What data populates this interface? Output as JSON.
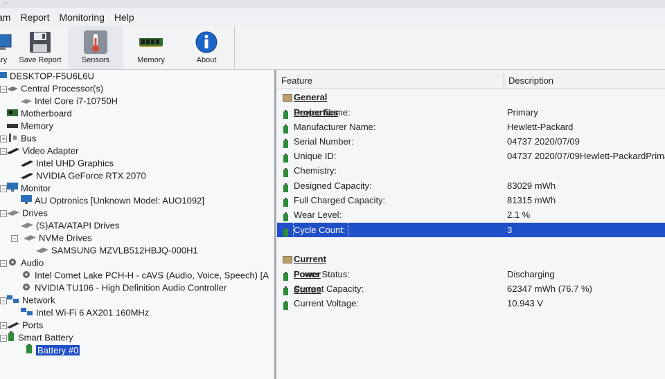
{
  "window": {
    "title_fragment": "..."
  },
  "menu": {
    "items": [
      "am",
      "Report",
      "Monitoring",
      "Help"
    ]
  },
  "toolbar": {
    "summary_label": "mary",
    "save_report_label": "Save Report",
    "sensors_label": "Sensors",
    "memory_label": "Memory",
    "about_label": "About"
  },
  "tree": {
    "root": "DESKTOP-F5U6L6U",
    "cpu": "Central Processor(s)",
    "cpu_item": "Intel Core i7-10750H",
    "motherboard": "Motherboard",
    "memory": "Memory",
    "bus": "Bus",
    "video": "Video Adapter",
    "video_item_1": "Intel UHD Graphics",
    "video_item_2": "NVIDIA GeForce RTX 2070",
    "monitor": "Monitor",
    "monitor_item": "AU Optronics [Unknown Model: AUO1092]",
    "drives": "Drives",
    "sata": "(S)ATA/ATAPI Drives",
    "nvme": "NVMe Drives",
    "nvme_item": "SAMSUNG MZVLB512HBJQ-000H1",
    "audio": "Audio",
    "audio_item_1": "Intel Comet Lake PCH-H - cAVS (Audio, Voice, Speech) [A",
    "audio_item_2": "NVIDIA TU106 - High Definition Audio Controller",
    "network": "Network",
    "network_item": "Intel Wi-Fi 6 AX201 160MHz",
    "ports": "Ports",
    "battery": "Smart Battery",
    "battery_item": "Battery #0"
  },
  "details": {
    "col_feature": "Feature",
    "col_description": "Description",
    "general_title": "General Properties",
    "device_name_label": "Device Name:",
    "device_name": "Primary",
    "manufacturer_label": "Manufacturer Name:",
    "manufacturer": "Hewlett-Packard",
    "serial_label": "Serial Number:",
    "serial": "04737 2020/07/09",
    "unique_label": "Unique ID:",
    "unique": "04737 2020/07/09Hewlett-PackardPrima",
    "chemistry_label": "Chemistry:",
    "chemistry": "",
    "designed_label": "Designed Capacity:",
    "designed": "83029 mWh",
    "full_label": "Full Charged Capacity:",
    "full": "81315 mWh",
    "wear_label": "Wear Level:",
    "wear": "2.1 %",
    "cycle_label": "Cycle Count:",
    "cycle": "3",
    "power_title": "Current Power Status",
    "power_status_label": "Power Status:",
    "power_status": "Discharging",
    "current_capacity_label": "Current Capacity:",
    "current_capacity": "62347 mWh (76.7 %)",
    "voltage_label": "Current Voltage:",
    "voltage": "10.943 V"
  },
  "colors": {
    "selection": "#1f4fc9",
    "battery_icon": "#2e8b3a",
    "about_icon": "#1c64c8",
    "sensor_icon": "#d5473a"
  }
}
